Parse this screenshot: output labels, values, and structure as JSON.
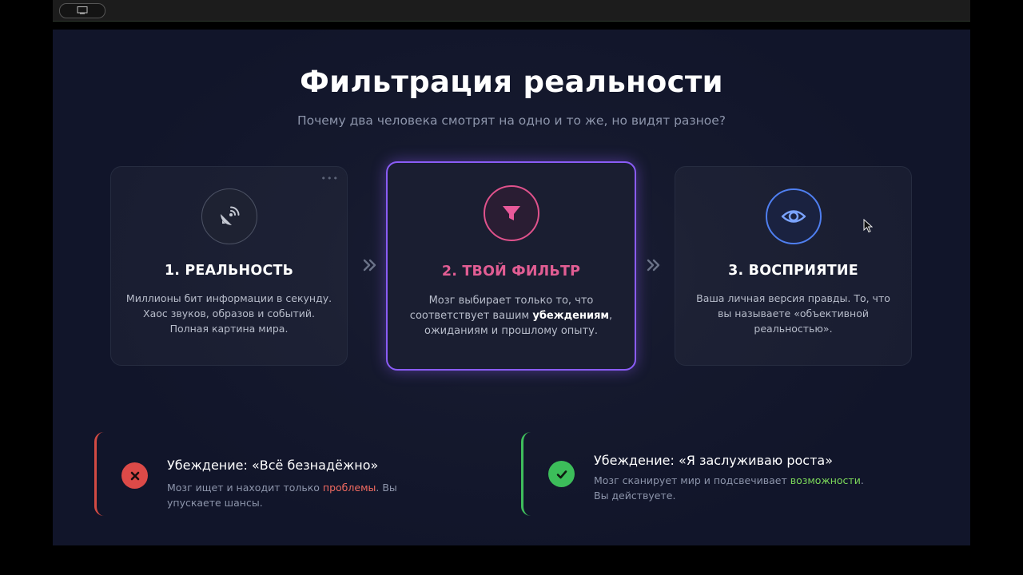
{
  "title": "Фильтрация реальности",
  "subtitle": "Почему два человека смотрят на одно и то же, но видят разное?",
  "cards": [
    {
      "icon": "satellite-dish-icon",
      "title": "1. РЕАЛЬНОСТЬ",
      "text": "Миллионы бит информации в секунду. Хаос звуков, образов и событий. Полная картина мира.",
      "menu": "•••"
    },
    {
      "icon": "funnel-icon",
      "title": "2. ТВОЙ ФИЛЬТР",
      "text_before": "Мозг выбирает только то, что соответствует вашим ",
      "text_bold": "убеждениям",
      "text_after": ", ожиданиям и прошлому опыту.",
      "accent": "#e15d93",
      "border": "#8a5cf6"
    },
    {
      "icon": "eye-icon",
      "title": "3. ВОСПРИЯТИЕ",
      "text": "Ваша личная версия правды. То, что вы называете «объективной реальностью»."
    }
  ],
  "beliefs": [
    {
      "icon": "cross-icon",
      "title": "Убеждение: «Всё безнадёжно»",
      "text_before": "Мозг ищет и находит только ",
      "highlight": "проблемы",
      "text_after": ". Вы упускаете шансы.",
      "color": "#dc4a48"
    },
    {
      "icon": "check-icon",
      "title": "Убеждение: «Я заслуживаю роста»",
      "text_before": "Мозг сканирует мир и подсвечивает ",
      "highlight": "возможности",
      "text_after": ". Вы действуете.",
      "color": "#3cbd5a"
    }
  ]
}
